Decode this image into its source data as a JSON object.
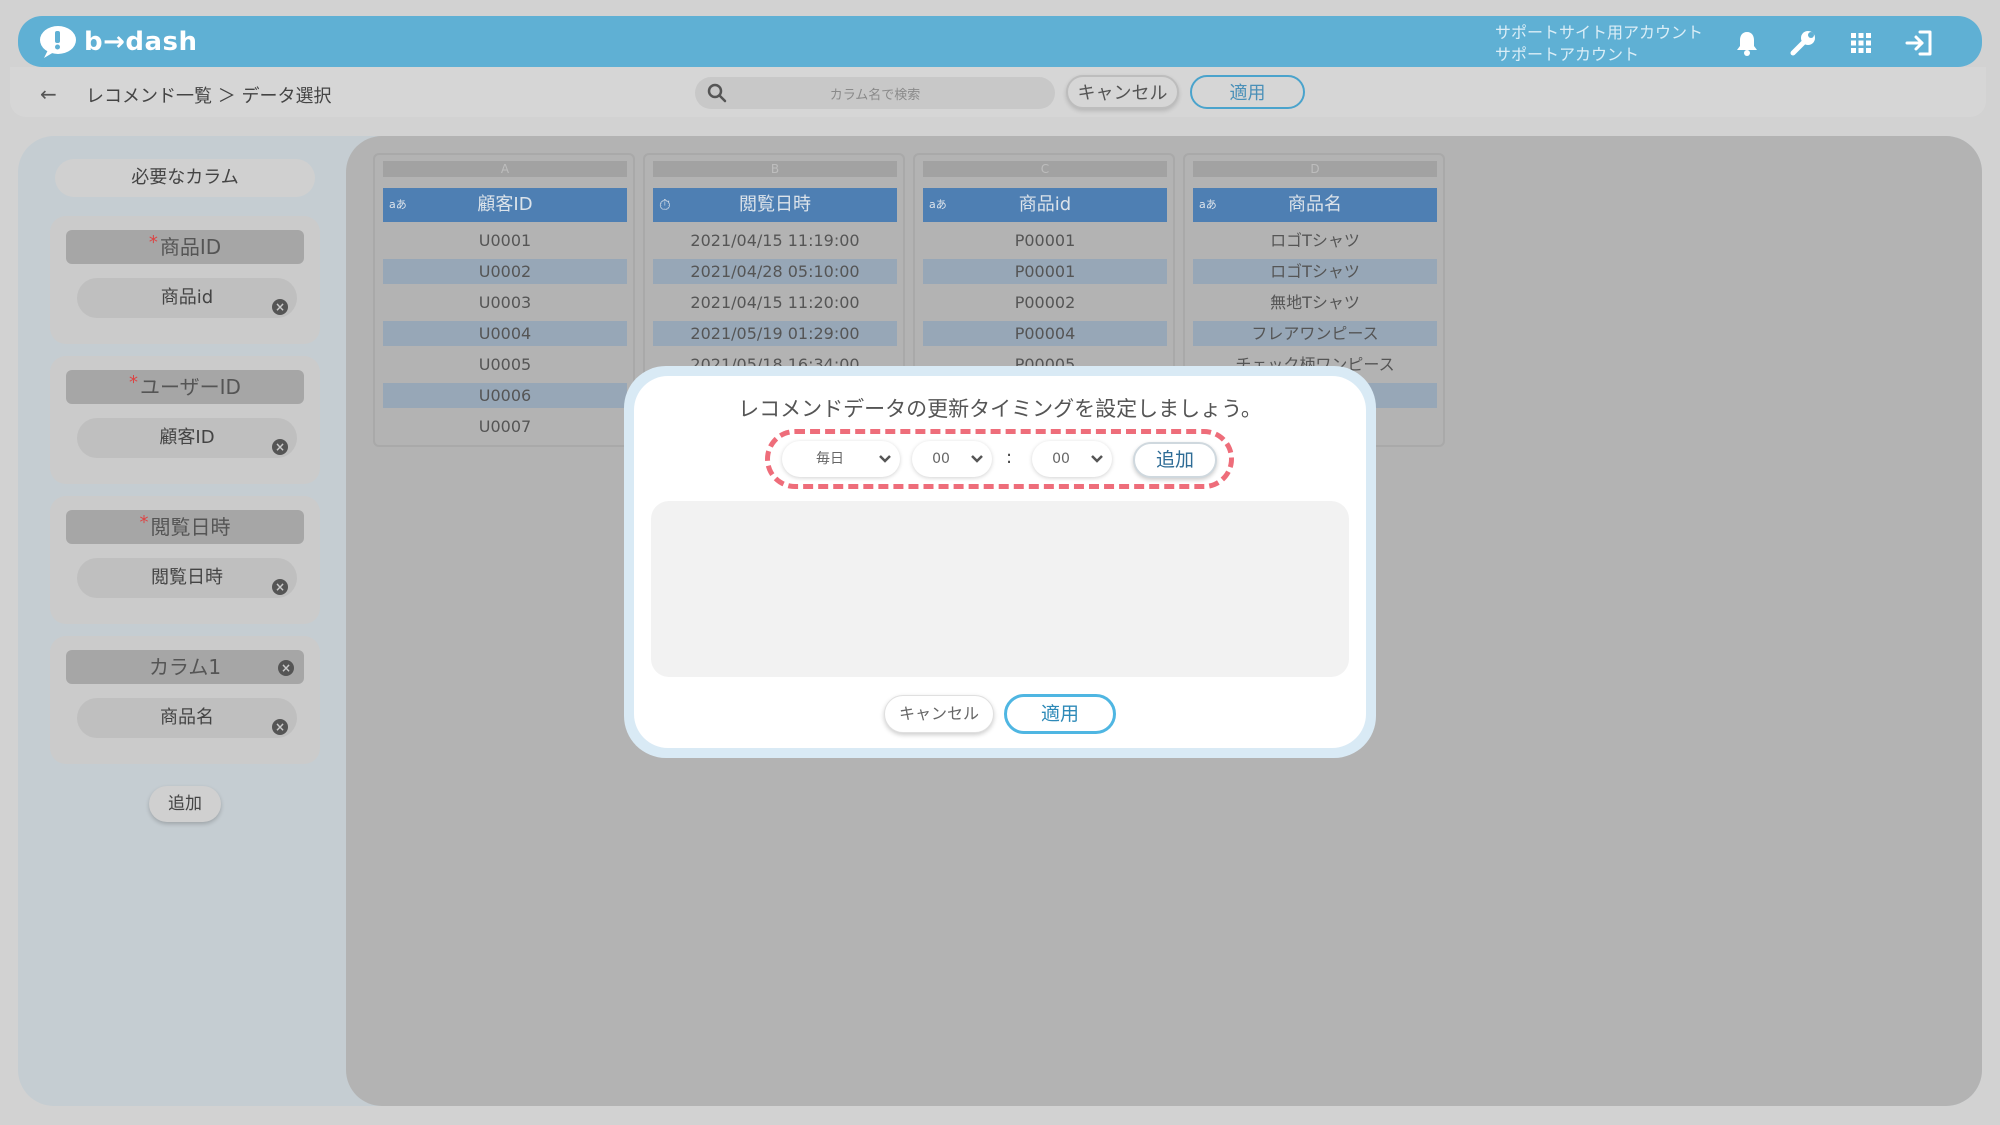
{
  "header": {
    "logo_text": "b→dash",
    "account_line1": "サポートサイト用アカウント",
    "account_line2": "サポートアカウント",
    "icons": [
      "bell-icon",
      "wrench-icon",
      "grid-icon",
      "logout-icon"
    ]
  },
  "subbar": {
    "breadcrumb": "レコメンド一覧 ＞ データ選択",
    "search_placeholder": "カラム名で検索",
    "cancel_label": "キャンセル",
    "apply_label": "適用"
  },
  "sidebar": {
    "title": "必要なカラム",
    "cards": [
      {
        "label": "商品ID",
        "required": true,
        "value": "商品id"
      },
      {
        "label": "ユーザーID",
        "required": true,
        "value": "顧客ID"
      },
      {
        "label": "閲覧日時",
        "required": true,
        "value": "閲覧日時"
      },
      {
        "label": "カラム1",
        "required": false,
        "value": "商品名"
      }
    ],
    "add_label": "追加"
  },
  "table": {
    "columns": [
      {
        "letter": "A",
        "type_icon": "text-type-icon",
        "header": "顧客ID",
        "cells": [
          "U0001",
          "U0002",
          "U0003",
          "U0004",
          "U0005",
          "U0006",
          "U0007"
        ]
      },
      {
        "letter": "B",
        "type_icon": "clock-icon",
        "header": "閲覧日時",
        "cells": [
          "2021/04/15 11:19:00",
          "2021/04/28 05:10:00",
          "2021/04/15 11:20:00",
          "2021/05/19 01:29:00",
          "2021/05/18 16:34:00"
        ]
      },
      {
        "letter": "C",
        "type_icon": "text-type-icon",
        "header": "商品id",
        "cells": [
          "P00001",
          "P00001",
          "P00002",
          "P00004",
          "P00005"
        ]
      },
      {
        "letter": "D",
        "type_icon": "text-type-icon",
        "header": "商品名",
        "cells": [
          "ロゴTシャツ",
          "ロゴTシャツ",
          "無地Tシャツ",
          "フレアワンピース",
          "チェック柄ワンピース"
        ]
      }
    ]
  },
  "modal": {
    "title": "レコメンドデータの更新タイミングを設定しましょう。",
    "frequency": "毎日",
    "hour": "00",
    "colon": ":",
    "minute": "00",
    "add_label": "追加",
    "cancel_label": "キャンセル",
    "apply_label": "適用"
  },
  "colors": {
    "header_bg": "#5fb0d4",
    "highlight_dashed": "#ee6d7a",
    "apply_border": "#4fb6e2",
    "table_header": "#4e7fb3"
  }
}
